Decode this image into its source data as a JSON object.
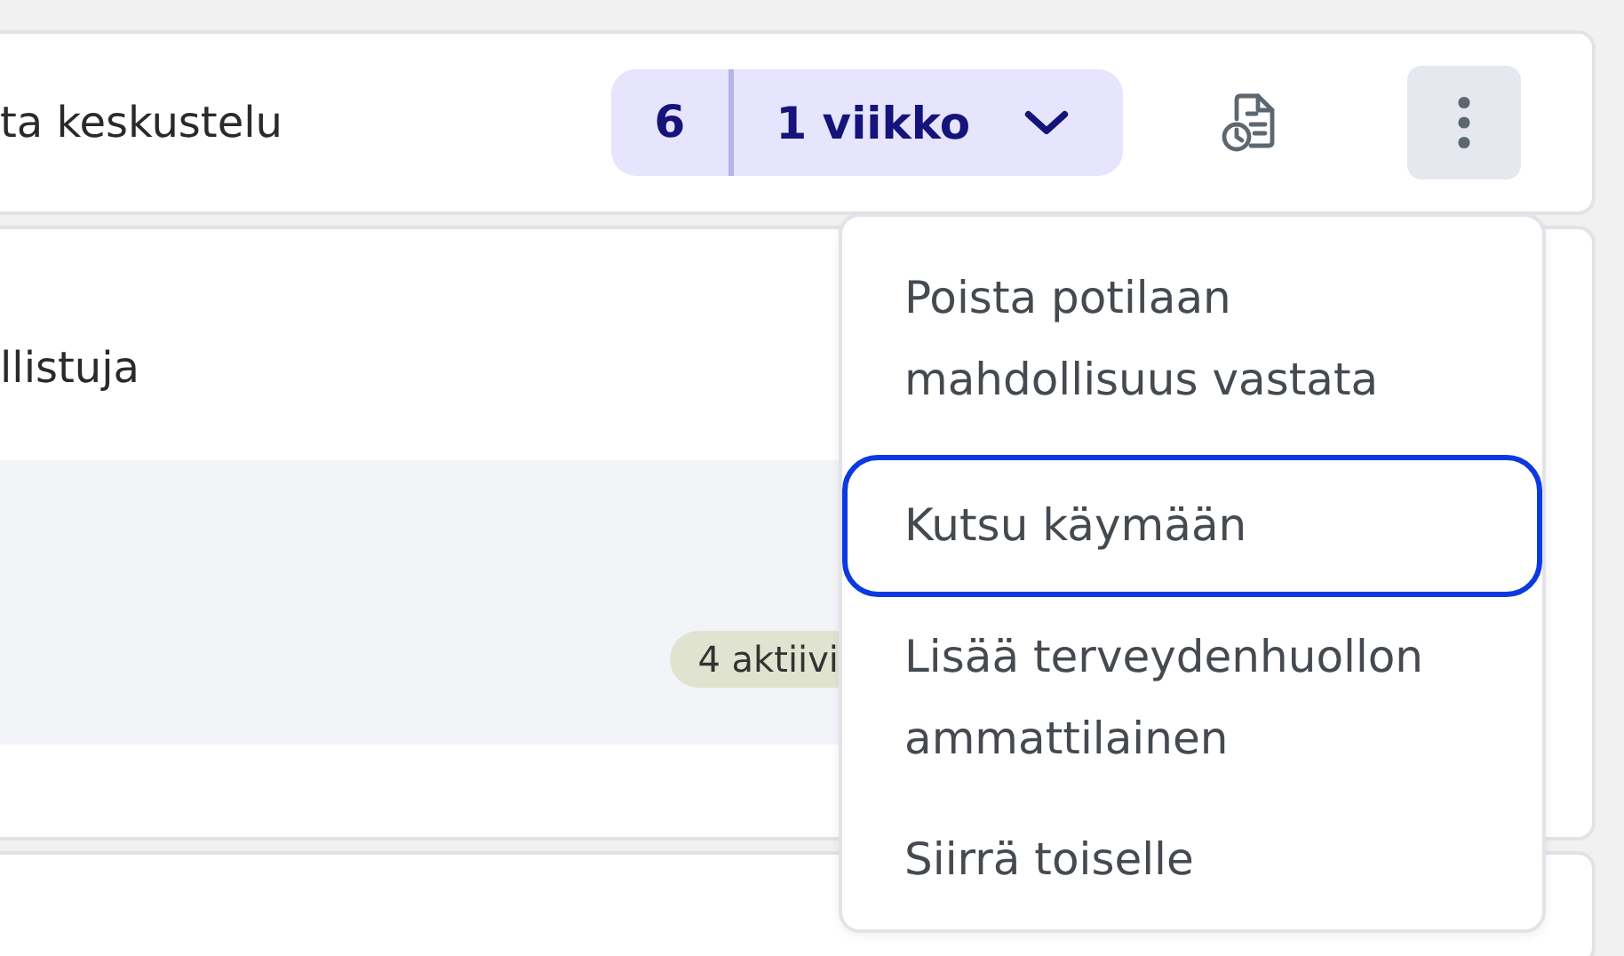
{
  "header": {
    "title": "ta keskustelu",
    "count": "6",
    "period": "1 viikko"
  },
  "participants": {
    "title": "llistuja",
    "badge": "4 aktiivi"
  },
  "menu": {
    "items": [
      {
        "label": "Poista potilaan mahdollisuus vastata",
        "selected": false
      },
      {
        "label": "Kutsu käymään",
        "selected": true
      },
      {
        "label": "Lisää terveydenhuollon ammattilainen",
        "selected": false
      },
      {
        "label": "Siirrä toiselle",
        "selected": false
      }
    ]
  }
}
